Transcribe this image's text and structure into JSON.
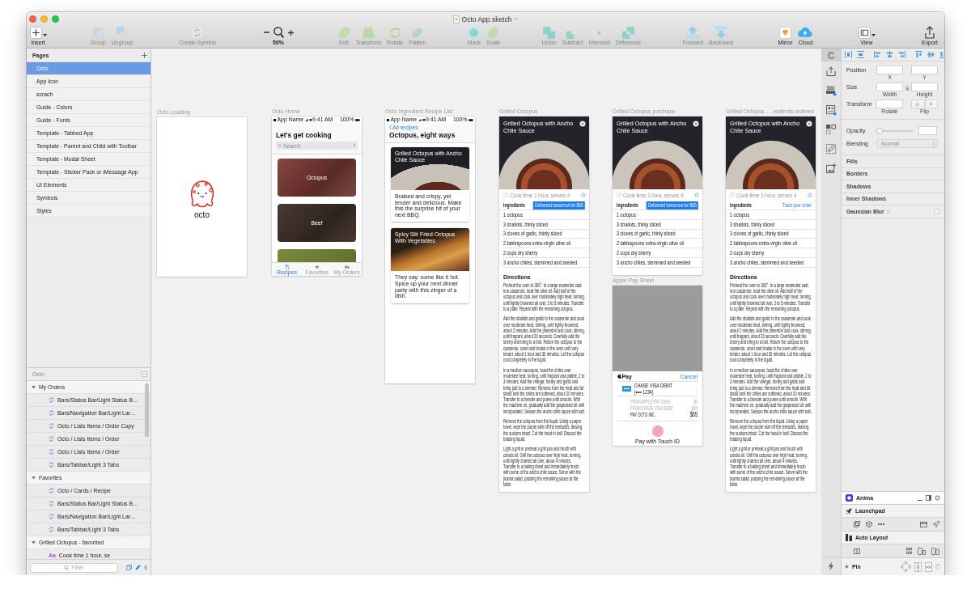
{
  "window": {
    "title": "Octo App.sketch"
  },
  "toolbar": [
    {
      "items": [
        {
          "label": "Insert",
          "kind": "menu",
          "disabled": false
        }
      ]
    },
    {
      "items": [
        {
          "label": "Group",
          "kind": "button",
          "disabled": true
        },
        {
          "label": "Ungroup",
          "kind": "button",
          "disabled": true
        }
      ]
    },
    {
      "items": [
        {
          "label": "Create Symbol",
          "kind": "button",
          "disabled": true
        }
      ]
    },
    {
      "items": [
        {
          "label": "50%",
          "kind": "zoom",
          "disabled": false
        }
      ]
    },
    {
      "items": [
        {
          "label": "Edit",
          "kind": "button",
          "disabled": true
        },
        {
          "label": "Transform",
          "kind": "button",
          "disabled": true
        },
        {
          "label": "Rotate",
          "kind": "button",
          "disabled": true
        },
        {
          "label": "Flatten",
          "kind": "button",
          "disabled": true
        }
      ]
    },
    {
      "items": [
        {
          "label": "Mask",
          "kind": "button",
          "disabled": true
        },
        {
          "label": "Scale",
          "kind": "button",
          "disabled": true
        }
      ]
    },
    {
      "items": [
        {
          "label": "Union",
          "kind": "button",
          "disabled": true
        },
        {
          "label": "Subtract",
          "kind": "button",
          "disabled": true
        },
        {
          "label": "Intersect",
          "kind": "button",
          "disabled": true
        },
        {
          "label": "Difference",
          "kind": "button",
          "disabled": true
        }
      ]
    },
    {
      "items": [
        {
          "label": "Forward",
          "kind": "button",
          "disabled": true
        },
        {
          "label": "Backward",
          "kind": "button",
          "disabled": true
        }
      ]
    },
    {
      "items": [
        {
          "label": "Mirror",
          "kind": "button",
          "disabled": false
        },
        {
          "label": "Cloud",
          "kind": "button",
          "disabled": false
        }
      ]
    },
    {
      "items": [
        {
          "label": "View",
          "kind": "menu",
          "disabled": false
        }
      ]
    },
    {
      "items": [
        {
          "label": "Export",
          "kind": "button",
          "disabled": false
        }
      ]
    }
  ],
  "sidebar": {
    "pages": {
      "title": "Pages",
      "items": [
        {
          "label": "Octo",
          "selected": true
        },
        {
          "label": "App Icon",
          "selected": false
        },
        {
          "label": "scrach",
          "selected": false
        },
        {
          "label": "Guide - Colors",
          "selected": false
        },
        {
          "label": "Guide - Fonts",
          "selected": false
        },
        {
          "label": "Template - Tabbed App",
          "selected": false
        },
        {
          "label": "Template - Parent and Child with Toolbar",
          "selected": false
        },
        {
          "label": "Template - Modal Sheet",
          "selected": false
        },
        {
          "label": "Template - Sticker Pack or iMessage App",
          "selected": false
        },
        {
          "label": "UI Elements",
          "selected": false
        },
        {
          "label": "Symbols",
          "selected": false
        },
        {
          "label": "Styles",
          "selected": false
        }
      ]
    },
    "layers": {
      "title": "Octo",
      "items": [
        {
          "label": "My Orders",
          "expanded": true,
          "children": [
            {
              "kind": "symbol",
              "label": "Bars/Status Bar/Light Status B…"
            },
            {
              "kind": "symbol",
              "label": "Bars/Navigation Bar/Light Lar…"
            },
            {
              "kind": "symbol",
              "label": "Octo / Lists Items / Order Copy"
            },
            {
              "kind": "symbol",
              "label": "Octo / Lists Items / Order"
            },
            {
              "kind": "symbol",
              "label": "Octo / Lists Items / Order"
            },
            {
              "kind": "symbol",
              "label": "Bars/Tabbar/Light 3 Tabs"
            }
          ]
        },
        {
          "label": "Favorites",
          "expanded": true,
          "children": [
            {
              "kind": "symbol",
              "label": "Octo / Cards / Recipe"
            },
            {
              "kind": "symbol",
              "label": "Bars/Status Bar/Light Status B…"
            },
            {
              "kind": "symbol",
              "label": "Bars/Navigation Bar/Light Lar…"
            },
            {
              "kind": "symbol",
              "label": "Bars/Tabbar/Light 3 Tabs"
            }
          ]
        },
        {
          "label": "Grilled Octopus - favorited",
          "expanded": true,
          "children": [
            {
              "kind": "text",
              "icon": "Aa",
              "label": "Cook time 1 hour, se"
            }
          ]
        }
      ],
      "filter": {
        "placeholder": "Filter"
      },
      "count": "6"
    }
  },
  "canvas": {
    "artboards": [
      {
        "kind": "loading",
        "title": "Octo Loading",
        "logo_text": "octo"
      },
      {
        "kind": "home",
        "title": "Octo Home",
        "status_bar": {
          "carrier": "App Name",
          "time": "9:41 AM",
          "battery": "100%"
        },
        "heading": "Let's get cooking",
        "search": {
          "placeholder": "Search"
        },
        "categories": [
          {
            "label": "Octopus"
          },
          {
            "label": "Beef"
          }
        ],
        "more_below": true,
        "tabs": [
          {
            "label": "Recipes",
            "selected": true
          },
          {
            "label": "Favorites",
            "selected": false
          },
          {
            "label": "My Orders",
            "selected": false
          }
        ]
      },
      {
        "kind": "recipe_list",
        "title": "Octo Ingredient Recipe List",
        "status_bar": {
          "carrier": "App Name",
          "time": "9:41 AM",
          "battery": "100%"
        },
        "back": "All recipes",
        "heading": "Octopus, eight ways",
        "cards": [
          {
            "title": "Grilled Octopus with Ancho Chile Sauce",
            "summary": "Braised and crispy, yet tender and delicious. Make this the surprise hit of your next BBQ."
          },
          {
            "title": "Spicy Stir Fried Octopus With Vegetables",
            "summary": "They say: some like it hot. Spice up your next dinner party with this zinger of a dish."
          }
        ]
      },
      {
        "kind": "recipe",
        "title": "Grilled Octopus",
        "photo_title": "Grilled Octopus with Ancho Chile Sauce",
        "cook_time": "Cook time 1 hour, serves 4",
        "ingredients_title": "Ingredients",
        "action": {
          "kind": "button",
          "label": "Delivered tomorrow for $65"
        },
        "ingredients": [
          "1 octopus",
          "3 shallots, thinly sliced",
          "3 cloves of garlic, thinly sliced",
          "2 tablespoons extra-virgin olive oil",
          "2 cups dry sherry",
          "3 ancho chiles, stemmed and seeded"
        ],
        "directions_title": "Directions",
        "directions": [
          "Preheat the oven to 300°. In a large enameled cast-iron casserole, heat the olive oil. Add half of the octopus and cook over moderately high heat, turning, until lightly browned all over, 3 to 5 minutes. Transfer to a plate. Repeat with the remaining octopus.",
          "Add the shallots and garlic to the casserole and cook over moderate heat, stirring, until lightly browned, about 2 minutes. Add the pimentón and cook, stirring, until fragrant, about 20 seconds. Carefully add the sherry and bring to a boil. Return the octopus to the casserole, cover and braise in the oven until very tender, about 1 hour and 30 minutes. Let the octopus cool completely in the liquid.",
          "In a medium saucepan, toast the chiles over moderate heat, turning, until fragrant and pliable, 2 to 3 minutes. Add the vinegar, honey and garlic and bring just to a simmer. Remove from the heat and let stand until the chiles are softened, about 20 minutes. Transfer to a blender and puree until smooth. With the machine on, gradually add the grapeseed oil until incorporated. Season the ancho chile sauce with salt.",
          "Remove the octopus from the liquid. Using a paper towel, wipe the purple skin off the tentacles, leaving the suckers intact. Cut the head in half. Discard the braising liquid.",
          "Light a grill or preheat a grill pan and brush with canola oil. Grill the octopus over high heat, turning, until lightly charred all over, about 4 minutes. Transfer to a baking sheet and immediately brush with some of the ancho chile sauce. Serve with the jicama salad, passing the remaining sauce at the table."
        ]
      },
      {
        "kind": "recipe",
        "title": "Grilled Octopus purchase",
        "photo_title": "Grilled Octopus with Ancho Chile Sauce",
        "cook_time": "Cook time 1 hour, serves 4",
        "ingredients_title": "Ingredients",
        "action": {
          "kind": "button",
          "label": "Delivered tomorrow for $65"
        },
        "ingredients": [
          "1 octopus",
          "3 shallots, thinly sliced",
          "3 cloves of garlic, thinly sliced",
          "2 tablespoons extra-virgin olive oil",
          "2 cups dry sherry",
          "3 ancho chiles, stemmed and seeded"
        ]
      },
      {
        "kind": "apple_pay",
        "title": "Apple Pay Sheet",
        "pay_label": "Pay",
        "cancel": "Cancel",
        "card": {
          "name": "CHASE VISA DEBIT",
          "number": "(•••• 1234)"
        },
        "lines": [
          {
            "label": "FROM APPLE PAY CASH",
            "amount": "$0"
          },
          {
            "label": "FROM CHASE VISA DEBIT",
            "amount": "$65"
          }
        ],
        "total": {
          "label": "PAY OCTO INC.",
          "amount": "$65"
        },
        "touch_id": "Pay with Touch ID"
      },
      {
        "kind": "recipe",
        "title": "Grilled Octopus -…redients ordered",
        "photo_title": "Grilled Octopus with Ancho Chile Sauce",
        "cook_time": "Cook time 1 hour, serves 4",
        "ingredients_title": "Ingredients",
        "action": {
          "kind": "link",
          "label": "Track your order"
        },
        "ingredients": [
          "1 octopus",
          "3 shallots, thinly sliced",
          "3 cloves of garlic, thinly sliced",
          "2 tablespoons extra-virgin olive oil",
          "2 cups dry sherry",
          "3 ancho chiles, stemmed and seeded"
        ],
        "directions_title": "Directions",
        "directions": [
          "Preheat the oven to 300°. In a large enameled cast-iron casserole, heat the olive oil. Add half of the octopus and cook over moderately high heat, turning, until lightly browned all over, 3 to 5 minutes. Transfer to a plate. Repeat with the remaining octopus.",
          "Add the shallots and garlic to the casserole and cook over moderate heat, stirring, until lightly browned, about 2 minutes. Add the pimentón and cook, stirring, until fragrant, about 20 seconds. Carefully add the sherry and bring to a boil. Return the octopus to the casserole, cover and braise in the oven until very tender, about 1 hour and 30 minutes. Let the octopus cool completely in the liquid.",
          "In a medium saucepan, toast the chiles over moderate heat, turning, until fragrant and pliable, 2 to 3 minutes. Add the vinegar, honey and garlic and bring just to a simmer. Remove from the heat and let stand until the chiles are softened, about 20 minutes. Transfer to a blender and puree until smooth. With the machine on, gradually add the grapeseed oil until incorporated. Season the ancho chile sauce with salt.",
          "Remove the octopus from the liquid. Using a paper towel, wipe the purple skin off the tentacles, leaving the suckers intact. Cut the head in half. Discard the braising liquid.",
          "Light a grill or preheat a grill pan and brush with canola oil. Grill the octopus over high heat, turning, until lightly charred all over, about 4 minutes. Transfer to a baking sheet and immediately brush with some of the ancho chile sauce. Serve with the jicama salad, passing the remaining sauce at the table."
        ]
      }
    ]
  },
  "inspector": {
    "properties": [
      {
        "kind": "pair",
        "label": "Position",
        "fields": [
          {
            "caption": "X"
          },
          {
            "caption": "Y"
          }
        ]
      },
      {
        "kind": "pair",
        "label": "Size",
        "fields": [
          {
            "caption": "Width"
          },
          {
            "caption": "Height"
          }
        ]
      },
      {
        "kind": "transform",
        "label": "Transform",
        "fields": [
          {
            "caption": "Rotate"
          }
        ],
        "flip": "Flip"
      },
      {
        "kind": "slider",
        "label": "Opacity",
        "level": 0
      },
      {
        "kind": "select",
        "label": "Blending",
        "value": "Normal"
      }
    ],
    "sections": [
      {
        "kind": "section",
        "label": "Fills"
      },
      {
        "kind": "section",
        "label": "Borders"
      },
      {
        "kind": "section",
        "label": "Shadows"
      },
      {
        "kind": "section",
        "label": "Inner Shadows"
      },
      {
        "kind": "toggle",
        "label": "Gaussian Blur",
        "checked": false
      }
    ],
    "plugins": [
      {
        "label": "Anima"
      },
      {
        "label": "Launchpad"
      },
      {
        "label": "Auto Layout"
      },
      {
        "label": "Pin"
      }
    ]
  }
}
